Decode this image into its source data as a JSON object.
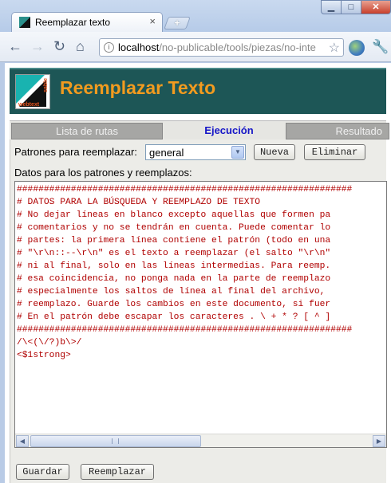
{
  "browser": {
    "tab_title": "Reemplazar texto",
    "new_tab_label": "+",
    "url_host": "localhost",
    "url_path": "/no-publicable/tools/piezas/no-inte"
  },
  "app": {
    "logo_text": "webtext",
    "logo_side_text": "sable",
    "title": "Reemplazar Texto"
  },
  "tabs": {
    "routes": "Lista de rutas",
    "execution": "Ejecución",
    "result": "Resultado"
  },
  "form": {
    "patterns_label": "Patrones para reemplazar:",
    "patterns_selected": "general",
    "new_button": "Nueva",
    "delete_button": "Eliminar",
    "data_label": "Datos para los patrones y reemplazos:",
    "save_button": "Guardar",
    "replace_button": "Reemplazar"
  },
  "editor": {
    "lines": [
      "##############################################################",
      "# DATOS PARA LA BÚSQUEDA Y REEMPLAZO DE TEXTO",
      "# No dejar líneas en blanco excepto aquellas que formen pa",
      "# comentarios y no se tendrán en cuenta. Puede comentar lo",
      "# partes: la primera línea contiene el patrón (todo en una",
      "# \"\\r\\n::--\\r\\n\" es el texto a reemplazar (el salto \"\\r\\n\"",
      "# ni al final, solo en las líneas intermedias. Para reemp.",
      "# esa coincidencia, no ponga nada en la parte de reemplazo",
      "# especialmente los saltos de línea al final del archivo,",
      "# reemplazo. Guarde los cambios en este documento, si fuer",
      "# En el patrón debe escapar los caracteres . \\ + * ? [ ^ ]",
      "##############################################################",
      "/\\<(\\/?)b\\>/",
      "<$1strong>"
    ]
  }
}
